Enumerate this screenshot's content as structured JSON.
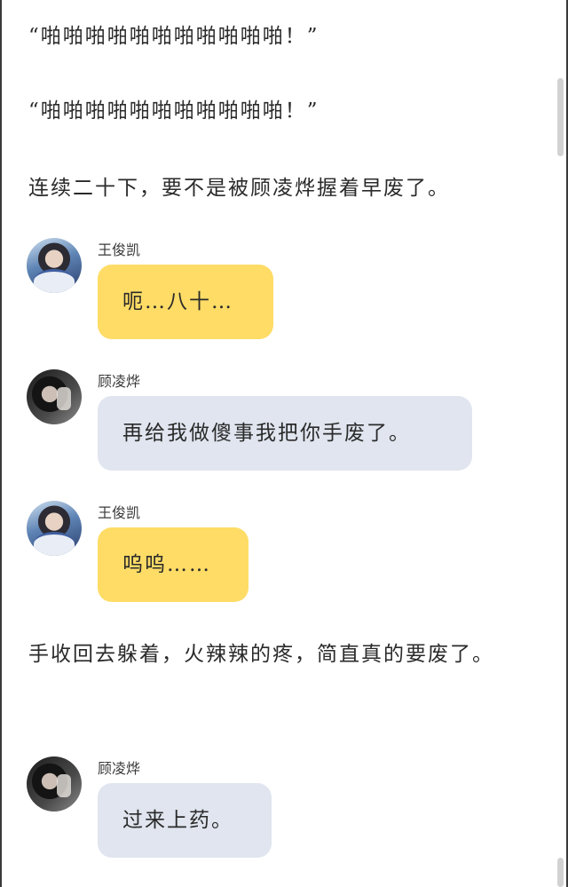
{
  "narration": [
    "“啪啪啪啪啪啪啪啪啪啪啪！”",
    "“啪啪啪啪啪啪啪啪啪啪啪！”",
    "连续二十下，要不是被顾凌烨握着早废了。",
    "手收回去躲着，火辣辣的疼，简直真的要废了。"
  ],
  "messages": [
    {
      "sender": "王俊凯",
      "text": "呃…八十…"
    },
    {
      "sender": "顾凌烨",
      "text": "再给我做傻事我把你手废了。"
    },
    {
      "sender": "王俊凯",
      "text": "呜呜……"
    },
    {
      "sender": "顾凌烨",
      "text": "过来上药。"
    }
  ],
  "colors": {
    "bubble_yellow": "#fedc66",
    "bubble_gray": "#e0e5ef"
  }
}
